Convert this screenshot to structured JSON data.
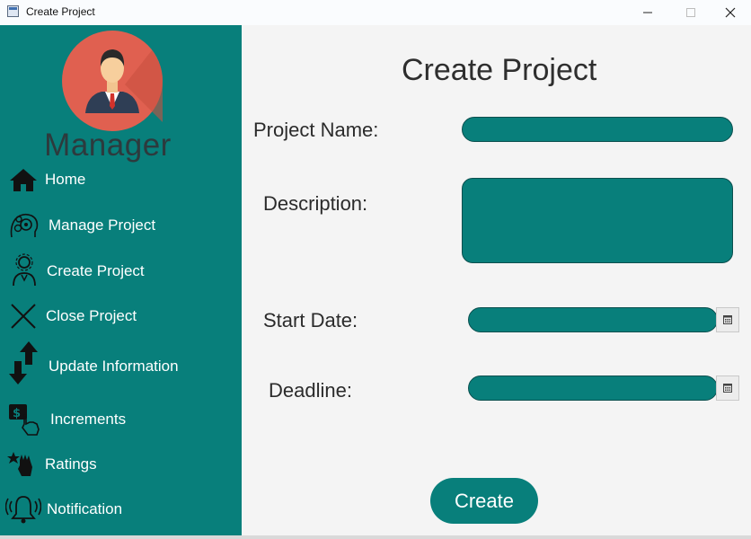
{
  "window": {
    "title": "Create Project"
  },
  "sidebar": {
    "role": "Manager",
    "items": [
      {
        "label": "Home",
        "icon": "home-icon"
      },
      {
        "label": "Manage Project",
        "icon": "gear-head-icon"
      },
      {
        "label": "Create Project",
        "icon": "person-gear-icon"
      },
      {
        "label": "Close Project",
        "icon": "close-x-icon"
      },
      {
        "label": "Update Information",
        "icon": "up-down-arrows-icon"
      },
      {
        "label": "Increments",
        "icon": "money-hand-icon"
      },
      {
        "label": "Ratings",
        "icon": "star-hand-icon"
      },
      {
        "label": "Notification",
        "icon": "bell-icon"
      }
    ]
  },
  "form": {
    "title": "Create Project",
    "project_name_label": "Project Name:",
    "description_label": "Description:",
    "start_date_label": "Start Date:",
    "deadline_label": "Deadline:",
    "project_name_value": "",
    "description_value": "",
    "start_date_value": "",
    "deadline_value": "",
    "submit_label": "Create"
  },
  "colors": {
    "accent": "#087f7b",
    "sidebar_bg": "#087f7b",
    "content_bg": "#f4f4f4"
  }
}
